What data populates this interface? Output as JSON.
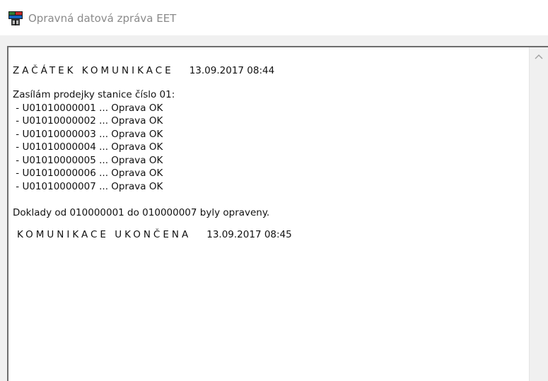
{
  "window": {
    "title": "Opravná datová zpráva EET",
    "icon": "eet-app-icon"
  },
  "log": {
    "start_heading": "ZAČÁTEK KOMUNIKACE",
    "start_time": "13.09.2017 08:44",
    "intro": "Zasílám prodejky stanice číslo 01:",
    "items": [
      " - U01010000001 ... Oprava OK",
      " - U01010000002 ... Oprava OK",
      " - U01010000003 ... Oprava OK",
      " - U01010000004 ... Oprava OK",
      " - U01010000005 ... Oprava OK",
      " - U01010000006 ... Oprava OK",
      " - U01010000007 ... Oprava OK"
    ],
    "summary": "Doklady od 010000001 do 010000007 byly opraveny.",
    "end_heading": "KOMUNIKACE UKONČENA",
    "end_time": "13.09.2017 08:45"
  },
  "scrollbar": {
    "up_icon": "chevron-up-icon"
  }
}
